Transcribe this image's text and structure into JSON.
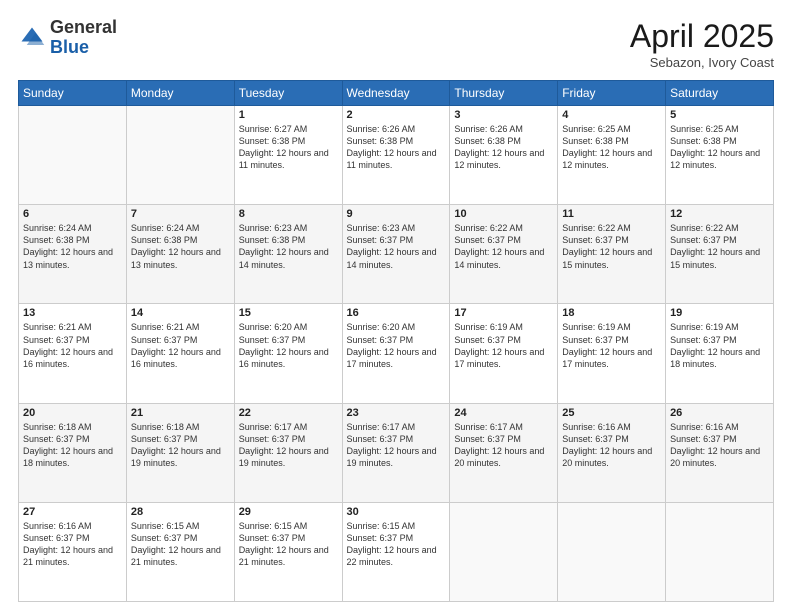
{
  "header": {
    "logo_general": "General",
    "logo_blue": "Blue",
    "title": "April 2025",
    "location": "Sebazon, Ivory Coast"
  },
  "days_of_week": [
    "Sunday",
    "Monday",
    "Tuesday",
    "Wednesday",
    "Thursday",
    "Friday",
    "Saturday"
  ],
  "weeks": [
    [
      {
        "day": "",
        "info": ""
      },
      {
        "day": "",
        "info": ""
      },
      {
        "day": "1",
        "info": "Sunrise: 6:27 AM\nSunset: 6:38 PM\nDaylight: 12 hours and 11 minutes."
      },
      {
        "day": "2",
        "info": "Sunrise: 6:26 AM\nSunset: 6:38 PM\nDaylight: 12 hours and 11 minutes."
      },
      {
        "day": "3",
        "info": "Sunrise: 6:26 AM\nSunset: 6:38 PM\nDaylight: 12 hours and 12 minutes."
      },
      {
        "day": "4",
        "info": "Sunrise: 6:25 AM\nSunset: 6:38 PM\nDaylight: 12 hours and 12 minutes."
      },
      {
        "day": "5",
        "info": "Sunrise: 6:25 AM\nSunset: 6:38 PM\nDaylight: 12 hours and 12 minutes."
      }
    ],
    [
      {
        "day": "6",
        "info": "Sunrise: 6:24 AM\nSunset: 6:38 PM\nDaylight: 12 hours and 13 minutes."
      },
      {
        "day": "7",
        "info": "Sunrise: 6:24 AM\nSunset: 6:38 PM\nDaylight: 12 hours and 13 minutes."
      },
      {
        "day": "8",
        "info": "Sunrise: 6:23 AM\nSunset: 6:38 PM\nDaylight: 12 hours and 14 minutes."
      },
      {
        "day": "9",
        "info": "Sunrise: 6:23 AM\nSunset: 6:37 PM\nDaylight: 12 hours and 14 minutes."
      },
      {
        "day": "10",
        "info": "Sunrise: 6:22 AM\nSunset: 6:37 PM\nDaylight: 12 hours and 14 minutes."
      },
      {
        "day": "11",
        "info": "Sunrise: 6:22 AM\nSunset: 6:37 PM\nDaylight: 12 hours and 15 minutes."
      },
      {
        "day": "12",
        "info": "Sunrise: 6:22 AM\nSunset: 6:37 PM\nDaylight: 12 hours and 15 minutes."
      }
    ],
    [
      {
        "day": "13",
        "info": "Sunrise: 6:21 AM\nSunset: 6:37 PM\nDaylight: 12 hours and 16 minutes."
      },
      {
        "day": "14",
        "info": "Sunrise: 6:21 AM\nSunset: 6:37 PM\nDaylight: 12 hours and 16 minutes."
      },
      {
        "day": "15",
        "info": "Sunrise: 6:20 AM\nSunset: 6:37 PM\nDaylight: 12 hours and 16 minutes."
      },
      {
        "day": "16",
        "info": "Sunrise: 6:20 AM\nSunset: 6:37 PM\nDaylight: 12 hours and 17 minutes."
      },
      {
        "day": "17",
        "info": "Sunrise: 6:19 AM\nSunset: 6:37 PM\nDaylight: 12 hours and 17 minutes."
      },
      {
        "day": "18",
        "info": "Sunrise: 6:19 AM\nSunset: 6:37 PM\nDaylight: 12 hours and 17 minutes."
      },
      {
        "day": "19",
        "info": "Sunrise: 6:19 AM\nSunset: 6:37 PM\nDaylight: 12 hours and 18 minutes."
      }
    ],
    [
      {
        "day": "20",
        "info": "Sunrise: 6:18 AM\nSunset: 6:37 PM\nDaylight: 12 hours and 18 minutes."
      },
      {
        "day": "21",
        "info": "Sunrise: 6:18 AM\nSunset: 6:37 PM\nDaylight: 12 hours and 19 minutes."
      },
      {
        "day": "22",
        "info": "Sunrise: 6:17 AM\nSunset: 6:37 PM\nDaylight: 12 hours and 19 minutes."
      },
      {
        "day": "23",
        "info": "Sunrise: 6:17 AM\nSunset: 6:37 PM\nDaylight: 12 hours and 19 minutes."
      },
      {
        "day": "24",
        "info": "Sunrise: 6:17 AM\nSunset: 6:37 PM\nDaylight: 12 hours and 20 minutes."
      },
      {
        "day": "25",
        "info": "Sunrise: 6:16 AM\nSunset: 6:37 PM\nDaylight: 12 hours and 20 minutes."
      },
      {
        "day": "26",
        "info": "Sunrise: 6:16 AM\nSunset: 6:37 PM\nDaylight: 12 hours and 20 minutes."
      }
    ],
    [
      {
        "day": "27",
        "info": "Sunrise: 6:16 AM\nSunset: 6:37 PM\nDaylight: 12 hours and 21 minutes."
      },
      {
        "day": "28",
        "info": "Sunrise: 6:15 AM\nSunset: 6:37 PM\nDaylight: 12 hours and 21 minutes."
      },
      {
        "day": "29",
        "info": "Sunrise: 6:15 AM\nSunset: 6:37 PM\nDaylight: 12 hours and 21 minutes."
      },
      {
        "day": "30",
        "info": "Sunrise: 6:15 AM\nSunset: 6:37 PM\nDaylight: 12 hours and 22 minutes."
      },
      {
        "day": "",
        "info": ""
      },
      {
        "day": "",
        "info": ""
      },
      {
        "day": "",
        "info": ""
      }
    ]
  ]
}
